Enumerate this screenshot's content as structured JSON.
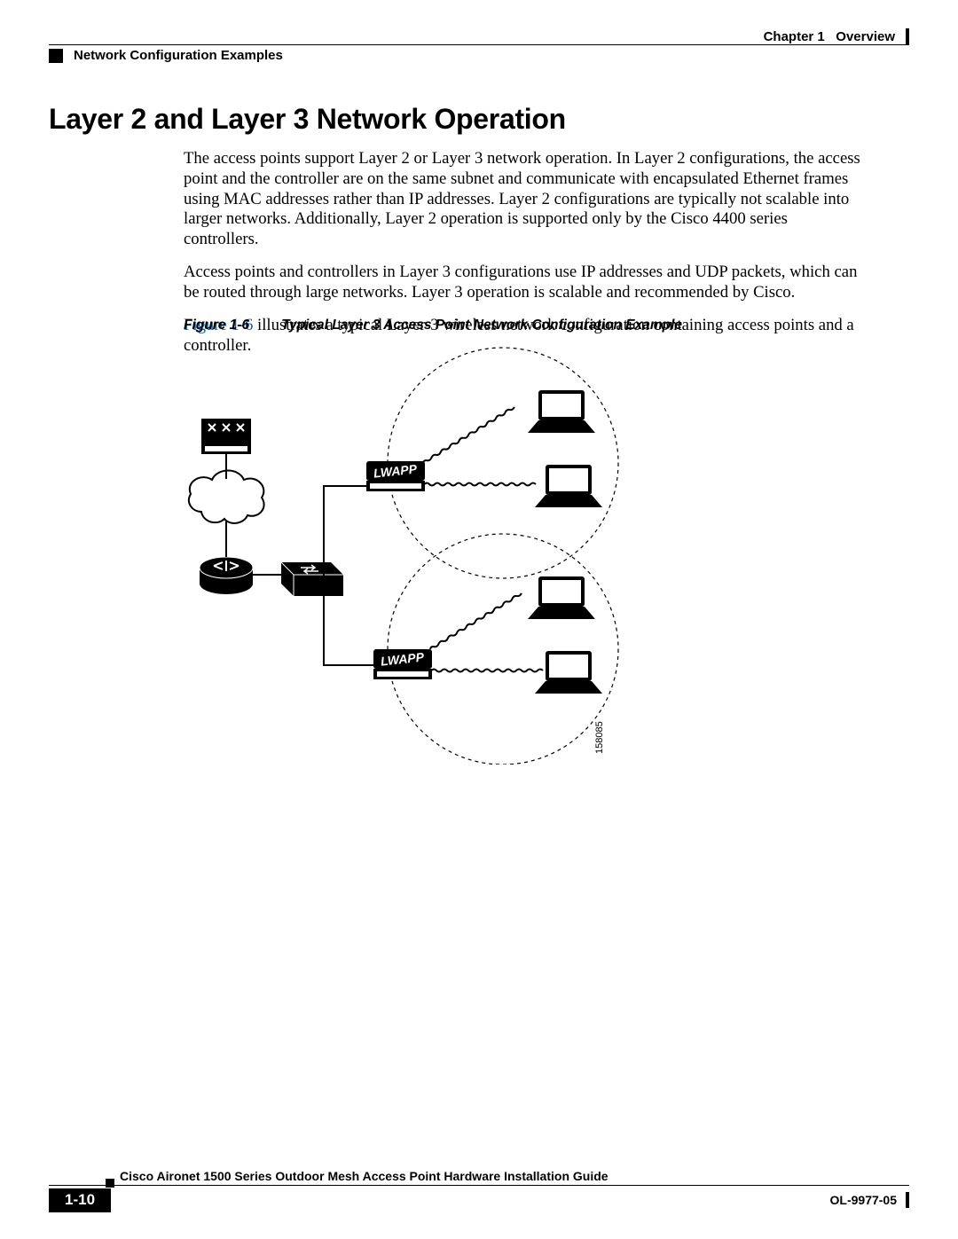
{
  "header": {
    "chapter": "Chapter 1",
    "chapter_title": "Overview",
    "section": "Network Configuration Examples"
  },
  "heading": "Layer 2 and Layer 3 Network Operation",
  "paragraphs": {
    "p1": "The access points support Layer 2 or Layer 3 network operation. In Layer 2 configurations, the access point and the controller are on the same subnet and communicate with encapsulated Ethernet frames using MAC addresses rather than IP addresses. Layer 2 configurations are typically not scalable into larger networks. Additionally, Layer 2 operation is supported only by the Cisco 4400 series controllers.",
    "p2": "Access points and controllers in Layer 3 configurations use IP addresses and UDP packets, which can be routed through large networks. Layer 3 operation is scalable and recommended by Cisco.",
    "p3_link": "Figure 1-6",
    "p3_rest": " illustrates a typical Layer-3 wireless network configuration containing access points and a controller."
  },
  "figure": {
    "number": "Figure 1-6",
    "caption": "Typical Layer 3 Access Point Network Configuration Example",
    "image_id_label": "158085",
    "ap_label": "LWAPP"
  },
  "footer": {
    "guide": "Cisco Aironet 1500 Series Outdoor Mesh Access Point Hardware Installation Guide",
    "page": "1-10",
    "docnum": "OL-9977-05"
  }
}
